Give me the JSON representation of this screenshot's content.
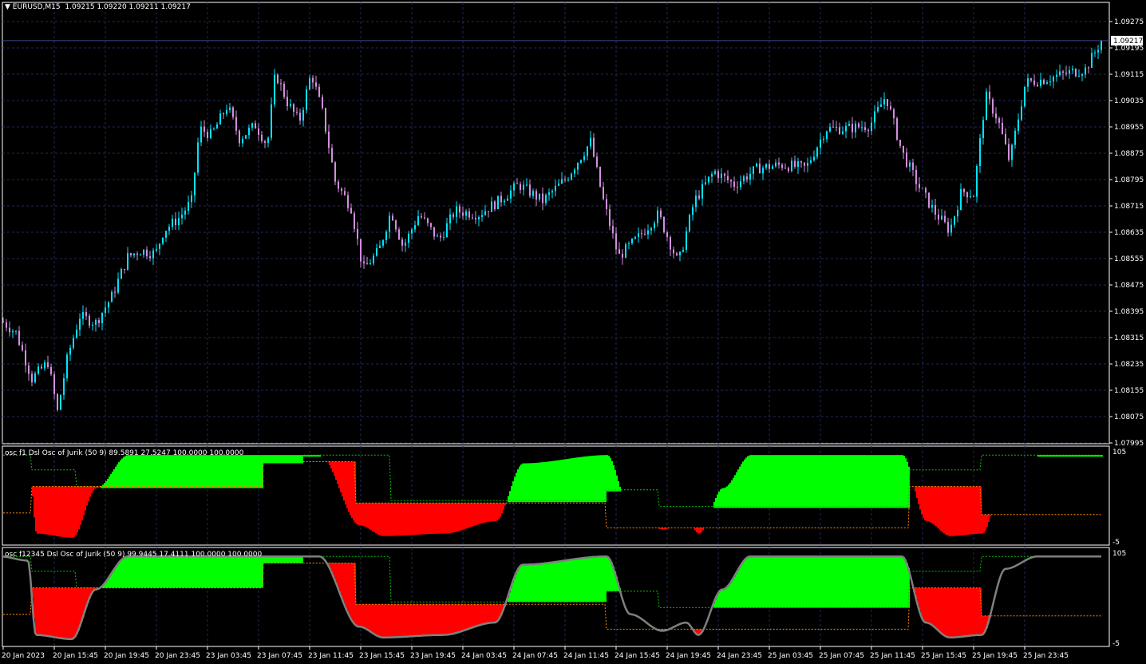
{
  "header": {
    "symbol": "EURUSD,M15",
    "ohlc": "1.09215 1.09220 1.09211 1.09217"
  },
  "current_price": "1.09217",
  "colors": {
    "background": "#000000",
    "grid": "#1f2a5a",
    "frame": "#ffffff",
    "bull": "#00e5ff",
    "bear": "#d48ee0",
    "osc_up": "#00ff00",
    "osc_down": "#ff0000",
    "osc_line": "#808080",
    "level_up": "#00c800",
    "level_down": "#ff8c00"
  },
  "price_axis": {
    "labels": [
      "1.09275",
      "1.09195",
      "1.09115",
      "1.09035",
      "1.08955",
      "1.08875",
      "1.08795",
      "1.08715",
      "1.08635",
      "1.08555",
      "1.08475",
      "1.08395",
      "1.08315",
      "1.08235",
      "1.08155",
      "1.08075",
      "1.07995"
    ],
    "min": 1.07995,
    "max": 1.09275
  },
  "time_axis": {
    "labels": [
      "20 Jan 2023",
      "20 Jan 15:45",
      "20 Jan 19:45",
      "20 Jan 23:45",
      "23 Jan 03:45",
      "23 Jan 07:45",
      "23 Jan 11:45",
      "23 Jan 15:45",
      "23 Jan 19:45",
      "24 Jan 03:45",
      "24 Jan 07:45",
      "24 Jan 11:45",
      "24 Jan 15:45",
      "24 Jan 19:45",
      "24 Jan 23:45",
      "25 Jan 03:45",
      "25 Jan 07:45",
      "25 Jan 11:45",
      "25 Jan 15:45",
      "25 Jan 19:45",
      "25 Jan 23:45"
    ]
  },
  "indicator1": {
    "title": "osc f1 Dsl Osc of Jurik (50 9) 89.5891 27.5247 100.0000 100.0000",
    "axis_top": "105",
    "axis_bottom": "-5"
  },
  "indicator2": {
    "title": "osc f12345 Dsl Osc of Jurik (50 9) 99.9445 17.4111 100.0000 100.0000",
    "axis_top": "105",
    "axis_bottom": "-5"
  },
  "chart_data": {
    "type": "candlestick",
    "title": "EURUSD,M15",
    "ylim": [
      1.07995,
      1.09275
    ],
    "price_path": [
      [
        0,
        1.0837
      ],
      [
        20,
        1.0833
      ],
      [
        40,
        1.0819
      ],
      [
        60,
        1.0824
      ],
      [
        72,
        1.0809
      ],
      [
        85,
        1.0826
      ],
      [
        100,
        1.0838
      ],
      [
        120,
        1.0836
      ],
      [
        140,
        1.0844
      ],
      [
        160,
        1.0856
      ],
      [
        175,
        1.0858
      ],
      [
        195,
        1.0857
      ],
      [
        205,
        1.0864
      ],
      [
        225,
        1.0868
      ],
      [
        240,
        1.0873
      ],
      [
        250,
        1.0895
      ],
      [
        265,
        1.0893
      ],
      [
        285,
        1.0902
      ],
      [
        300,
        1.0892
      ],
      [
        320,
        1.0896
      ],
      [
        335,
        1.089
      ],
      [
        345,
        1.0912
      ],
      [
        360,
        1.0903
      ],
      [
        375,
        1.0897
      ],
      [
        390,
        1.0912
      ],
      [
        405,
        1.0899
      ],
      [
        420,
        1.0879
      ],
      [
        440,
        1.0871
      ],
      [
        455,
        1.0852
      ],
      [
        475,
        1.0858
      ],
      [
        490,
        1.087
      ],
      [
        505,
        1.0859
      ],
      [
        525,
        1.0869
      ],
      [
        550,
        1.0861
      ],
      [
        570,
        1.087
      ],
      [
        600,
        1.0869
      ],
      [
        625,
        1.0873
      ],
      [
        650,
        1.0878
      ],
      [
        680,
        1.0873
      ],
      [
        710,
        1.088
      ],
      [
        740,
        1.0891
      ],
      [
        755,
        1.0874
      ],
      [
        775,
        1.0856
      ],
      [
        800,
        1.0862
      ],
      [
        825,
        1.0869
      ],
      [
        850,
        1.0854
      ],
      [
        870,
        1.0873
      ],
      [
        895,
        1.0882
      ],
      [
        920,
        1.0878
      ],
      [
        950,
        1.0883
      ],
      [
        980,
        1.0884
      ],
      [
        1010,
        1.0883
      ],
      [
        1035,
        1.0895
      ],
      [
        1060,
        1.0895
      ],
      [
        1090,
        1.0896
      ],
      [
        1110,
        1.0905
      ],
      [
        1130,
        1.0888
      ],
      [
        1150,
        1.0878
      ],
      [
        1170,
        1.087
      ],
      [
        1190,
        1.0864
      ],
      [
        1205,
        1.0876
      ],
      [
        1220,
        1.0875
      ],
      [
        1235,
        1.0905
      ],
      [
        1250,
        1.0898
      ],
      [
        1265,
        1.0885
      ],
      [
        1285,
        1.0909
      ],
      [
        1310,
        1.091
      ],
      [
        1340,
        1.0912
      ],
      [
        1360,
        1.0913
      ],
      [
        1380,
        1.09217
      ]
    ],
    "oscillators": [
      {
        "name": "osc f1 Dsl Osc of Jurik (50 9)",
        "values": [
          89.5891,
          27.5247,
          100.0,
          100.0
        ],
        "ylim": [
          -5,
          105
        ]
      },
      {
        "name": "osc f12345 Dsl Osc of Jurik (50 9)",
        "values": [
          99.9445,
          17.4111,
          100.0,
          100.0
        ],
        "ylim": [
          -5,
          105
        ]
      }
    ]
  }
}
